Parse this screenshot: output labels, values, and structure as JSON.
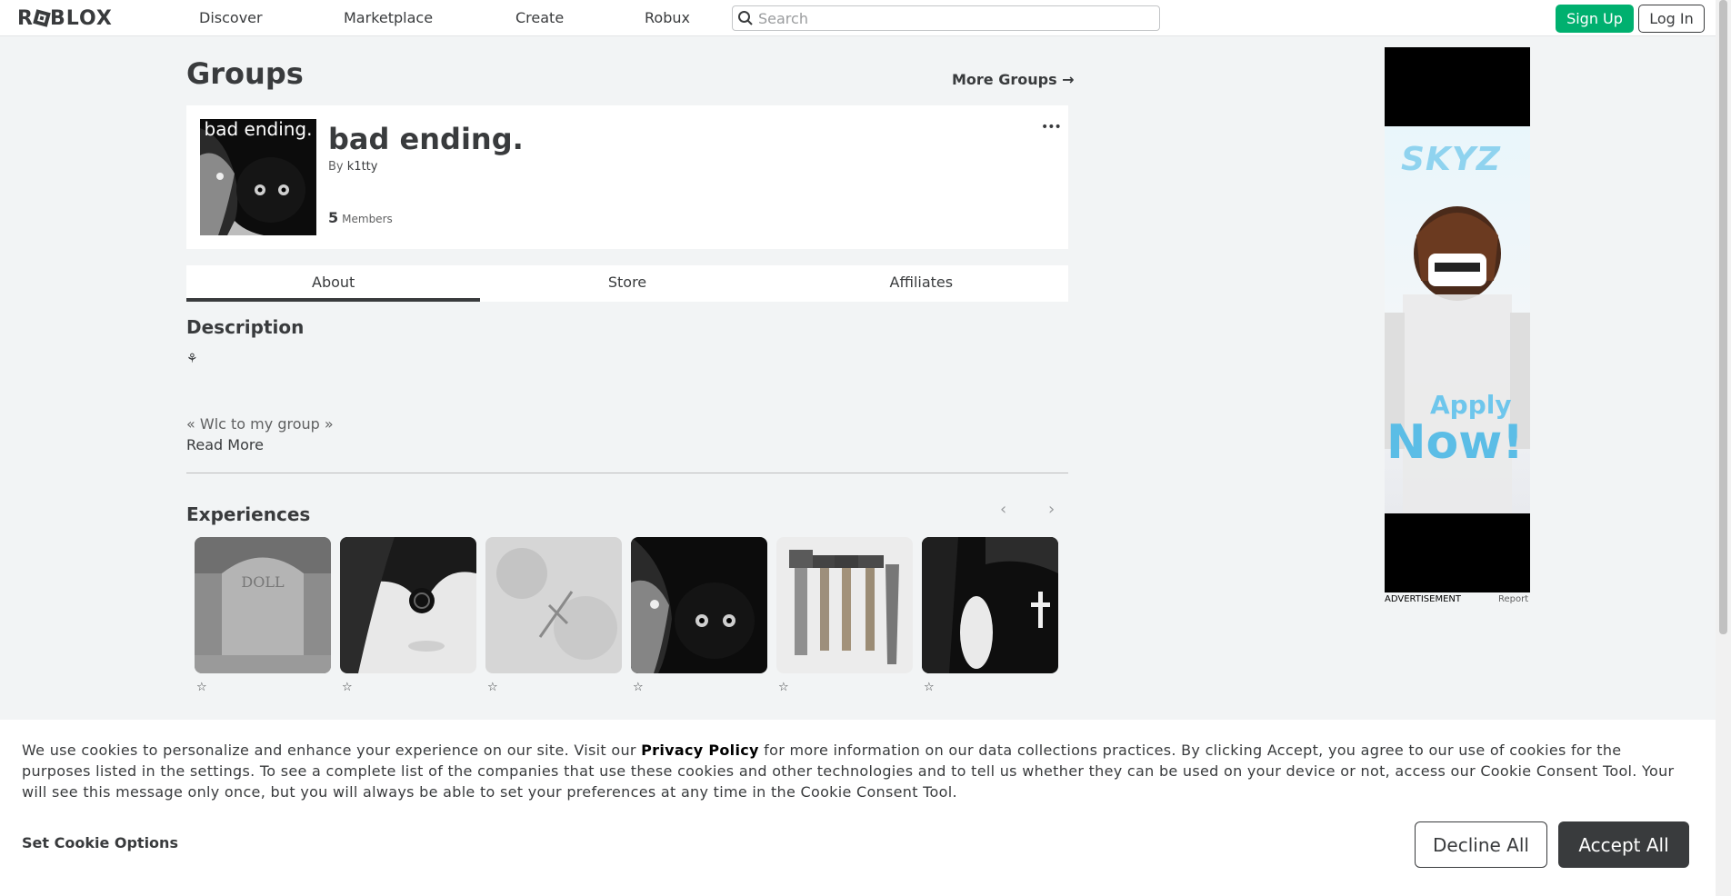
{
  "nav": {
    "logo": "ROBLOX",
    "links": [
      "Discover",
      "Marketplace",
      "Create",
      "Robux"
    ],
    "search_placeholder": "Search",
    "signup_label": "Sign Up",
    "login_label": "Log In"
  },
  "page": {
    "title": "Groups",
    "more_groups": "More Groups →"
  },
  "group": {
    "thumb_text": "bad ending.",
    "name": "bad ending.",
    "by_prefix": "By",
    "owner": "k1tty",
    "member_count": "5",
    "members_label": "Members",
    "more_menu": "•••"
  },
  "tabs": [
    {
      "label": "About",
      "active": true
    },
    {
      "label": "Store",
      "active": false
    },
    {
      "label": "Affiliates",
      "active": false
    }
  ],
  "description": {
    "heading": "Description",
    "symbol": "⚘",
    "text": "« Wlc to my group »",
    "read_more": "Read More"
  },
  "experiences": {
    "heading": "Experiences",
    "prev": "‹",
    "next": "›",
    "tiles": [
      {
        "image": "gravestone-doll",
        "rating": "☆"
      },
      {
        "image": "pale-face-hair",
        "rating": "☆"
      },
      {
        "image": "lace-crucifix",
        "rating": "☆"
      },
      {
        "image": "girl-black-cat",
        "rating": "☆"
      },
      {
        "image": "hammers-and-tools",
        "rating": "☆"
      },
      {
        "image": "dark-forest-cross",
        "rating": "☆"
      }
    ]
  },
  "ad": {
    "brand": "SKYZ",
    "apply": "Apply",
    "now": "Now!",
    "label": "ADVERTISEMENT",
    "report": "Report"
  },
  "cookie": {
    "text_before": "We use cookies to personalize and enhance your experience on our site. Visit our ",
    "privacy_link": "Privacy Policy",
    "text_after": " for more information on our data collections practices. By clicking Accept, you agree to our use of cookies for the purposes listed in the settings. To see a complete list of the companies that use these cookies and other technologies and to tell us whether they can be used on your device or not, access our Cookie Consent Tool. Your will see this message only once, but you will always be able to set your preferences at any time in the Cookie Consent Tool.",
    "options_label": "Set Cookie Options",
    "decline_label": "Decline All",
    "accept_label": "Accept All"
  }
}
